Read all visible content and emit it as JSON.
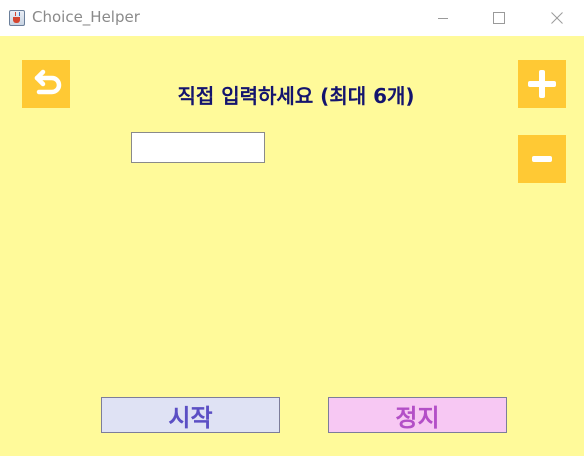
{
  "window": {
    "title": "Choice_Helper",
    "icons": {
      "app": "java-icon",
      "minimize": "minimize-icon",
      "maximize": "maximize-icon",
      "close": "close-icon"
    }
  },
  "main": {
    "heading": "직접 입력하세요 (최대 6개)",
    "back_icon": "back-arrow-icon",
    "add_icon": "plus-icon",
    "remove_icon": "minus-icon",
    "choice_input": {
      "value": "",
      "placeholder": ""
    }
  },
  "actions": {
    "start_label": "시작",
    "stop_label": "정지"
  },
  "colors": {
    "background": "#fffa9a",
    "icon_button": "#ffc934",
    "heading_text": "#14146e",
    "start_bg": "#dfe2f4",
    "start_text": "#5b4fc4",
    "stop_bg": "#f7c8f3",
    "stop_text": "#b34fc7"
  }
}
